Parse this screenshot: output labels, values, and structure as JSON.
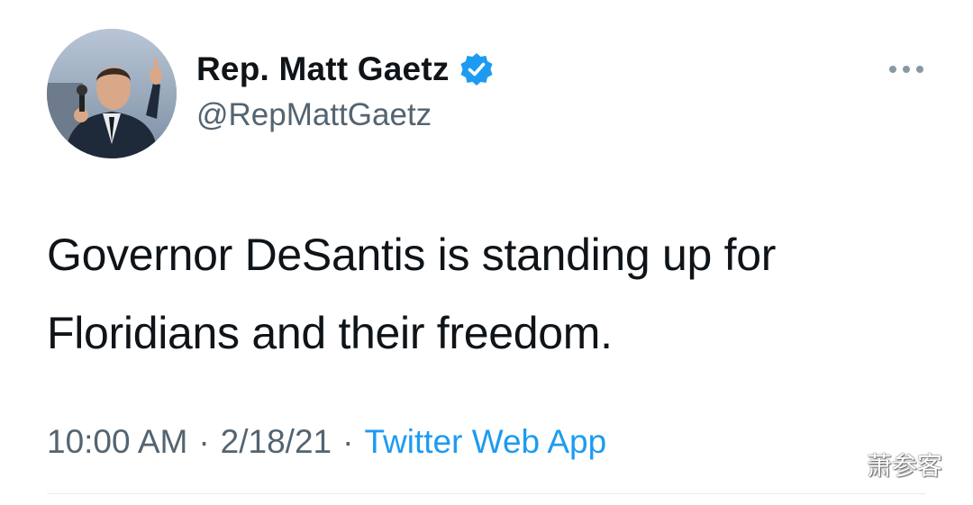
{
  "tweet": {
    "author": {
      "display_name": "Rep. Matt Gaetz",
      "handle": "@RepMattGaetz",
      "verified": true,
      "avatar_icon": "profile-photo"
    },
    "more_icon": "more-horizontal-icon",
    "text_line1": "Governor DeSantis is standing up for",
    "text_line2": "Floridians and their freedom.",
    "time": "10:00 AM",
    "separator": "·",
    "date": "2/18/21",
    "source": "Twitter Web App"
  },
  "watermark": {
    "icon": "wechat-icon",
    "text": "萧参客"
  },
  "colors": {
    "text": "#0f1419",
    "secondary": "#536471",
    "accent": "#1d9bf0"
  }
}
